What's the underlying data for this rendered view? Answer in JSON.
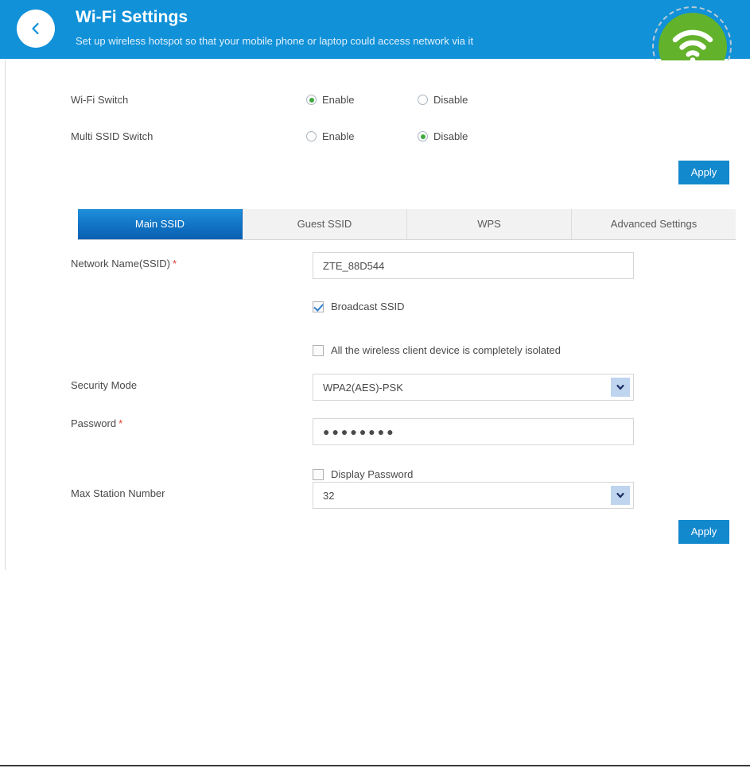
{
  "header": {
    "back_icon": "chevron-left-icon",
    "title": "Wi-Fi Settings",
    "subtitle": "Set up wireless hotspot so that your mobile phone or laptop could access network via it",
    "badge_icon": "wifi-icon",
    "bg_color": "#1191d8",
    "badge_color": "#62b22c"
  },
  "switches": [
    {
      "label": "Wi-Fi Switch",
      "options": [
        {
          "label": "Enable",
          "selected": true
        },
        {
          "label": "Disable",
          "selected": false
        }
      ]
    },
    {
      "label": "Multi SSID Switch",
      "options": [
        {
          "label": "Enable",
          "selected": false
        },
        {
          "label": "Disable",
          "selected": true
        }
      ]
    }
  ],
  "apply_top_label": "Apply",
  "tabs": [
    {
      "label": "Main SSID",
      "active": true
    },
    {
      "label": "Guest SSID",
      "active": false
    },
    {
      "label": "WPS",
      "active": false
    },
    {
      "label": "Advanced Settings",
      "active": false
    }
  ],
  "form": {
    "ssid": {
      "label": "Network Name(SSID)",
      "required": "*",
      "value": "ZTE_88D544",
      "placeholder": ""
    },
    "broadcast_ssid": {
      "label": "Broadcast SSID",
      "checked": true
    },
    "isolation": {
      "label": "All the wireless client device is completely isolated",
      "checked": false
    },
    "security_mode": {
      "label": "Security Mode",
      "value": "WPA2(AES)-PSK",
      "options": [
        "WPA2(AES)-PSK"
      ],
      "arrow_icon": "chevron-down-icon"
    },
    "password": {
      "label": "Password",
      "required": "*",
      "masked_value": "●●●●●●●●",
      "placeholder": ""
    },
    "display_password": {
      "label": "Display Password",
      "checked": false
    },
    "max_station": {
      "label": "Max Station Number",
      "value": "32",
      "options": [
        "32"
      ],
      "arrow_icon": "chevron-down-icon"
    }
  },
  "apply_bottom_label": "Apply",
  "colors": {
    "accent_blue": "#1389cd",
    "radio_green": "#3ea93e",
    "required_red": "#e03a2f",
    "check_blue": "#2e7fd1"
  }
}
